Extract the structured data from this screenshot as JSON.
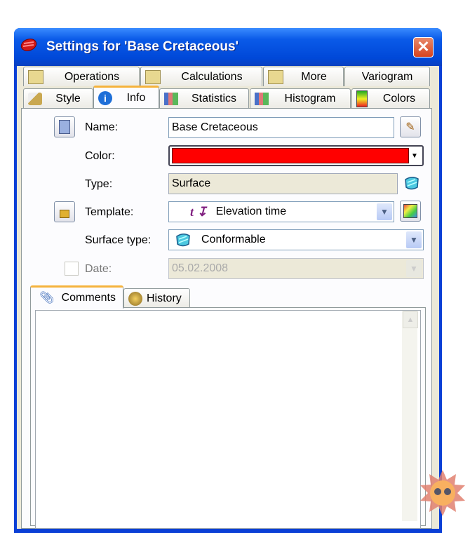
{
  "window": {
    "title": "Settings for 'Base Cretaceous'",
    "close": "✕"
  },
  "tabs_row1": [
    {
      "label": "Operations",
      "icon": "folder-search-icon"
    },
    {
      "label": "Calculations",
      "icon": "folder-search-icon"
    },
    {
      "label": "More",
      "icon": "folder-search-icon"
    },
    {
      "label": "Variogram"
    }
  ],
  "tabs_row2": [
    {
      "label": "Style",
      "icon": "brush-icon"
    },
    {
      "label": "Info",
      "icon": "info-icon",
      "active": true
    },
    {
      "label": "Statistics",
      "icon": "bar-chart-icon"
    },
    {
      "label": "Histogram",
      "icon": "histogram-icon"
    },
    {
      "label": "Colors",
      "icon": "color-scale-icon"
    }
  ],
  "form": {
    "name_label": "Name:",
    "name_value": "Base Cretaceous",
    "color_label": "Color:",
    "color_value": "#ff0000",
    "type_label": "Type:",
    "type_value": "Surface",
    "template_label": "Template:",
    "template_value": "Elevation time",
    "template_symbol": "t",
    "surface_type_label": "Surface type:",
    "surface_type_value": "Conformable",
    "date_label": "Date:",
    "date_value": "05.02.2008",
    "date_checked": false
  },
  "inner_tabs": [
    {
      "label": "Comments",
      "icon": "paperclip-icon",
      "active": true
    },
    {
      "label": "History",
      "icon": "clock-icon"
    }
  ],
  "comments": {
    "text": ""
  }
}
